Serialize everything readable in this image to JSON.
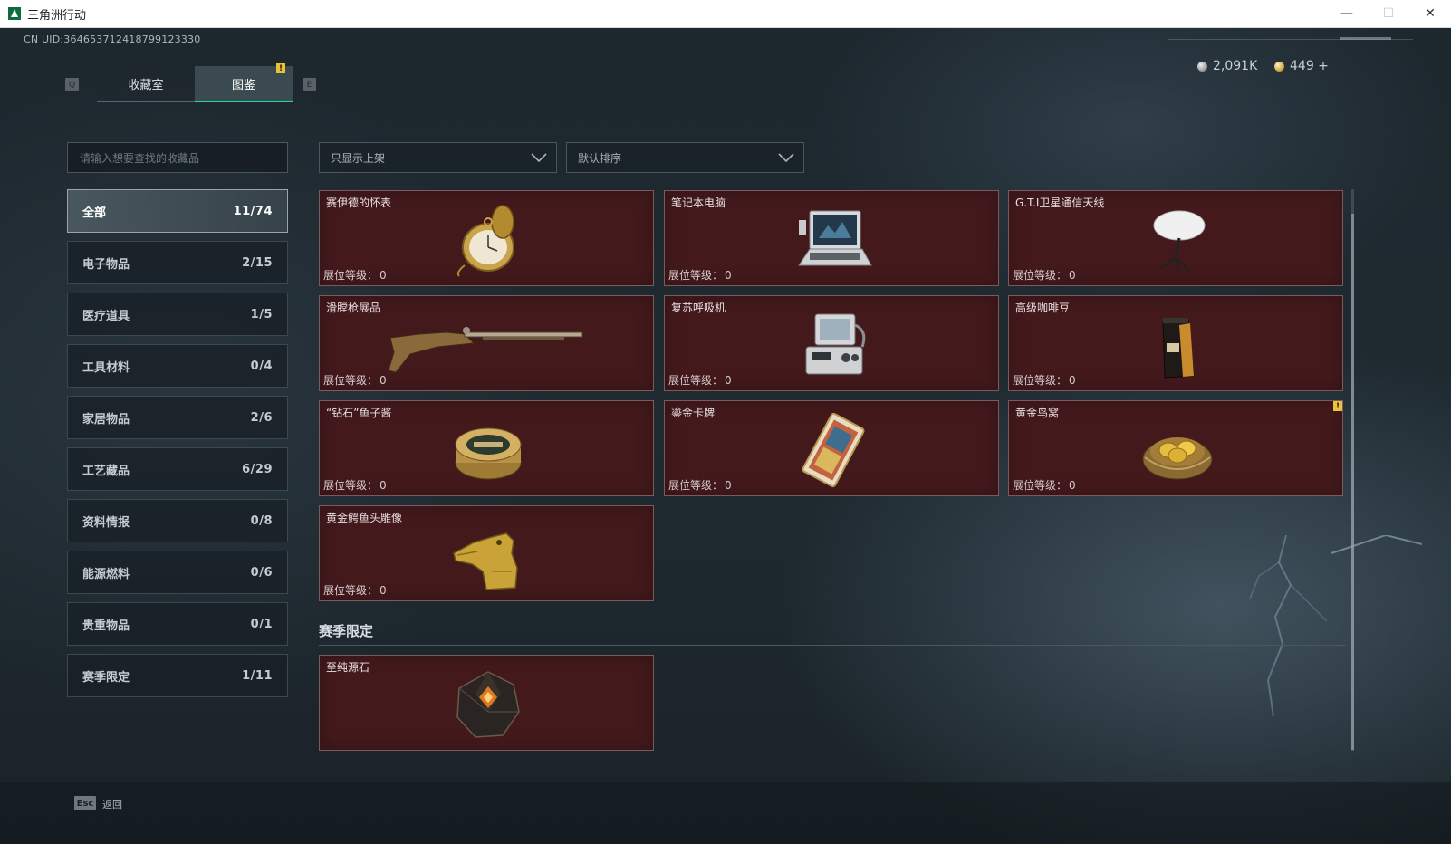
{
  "window": {
    "title": "三角洲行动",
    "controls": {
      "minimize": "—",
      "maximize": "☐",
      "close": "✕"
    }
  },
  "header": {
    "uid": "CN UID:364653712418799123330",
    "tab_prev_key": "Q",
    "tab_next_key": "E",
    "tabs": [
      {
        "label": "收藏室",
        "active": false
      },
      {
        "label": "图鉴",
        "active": true,
        "badge": "!"
      }
    ],
    "currency": [
      {
        "icon": "silver-coin-icon",
        "value": "2,091K"
      },
      {
        "icon": "gold-coin-icon",
        "value": "449 +"
      }
    ]
  },
  "sidebar": {
    "search_placeholder": "请输入想要查找的收藏品",
    "categories": [
      {
        "label": "全部",
        "count": "11/74",
        "active": true
      },
      {
        "label": "电子物品",
        "count": "2/15"
      },
      {
        "label": "医疗道具",
        "count": "1/5"
      },
      {
        "label": "工具材料",
        "count": "0/4"
      },
      {
        "label": "家居物品",
        "count": "2/6"
      },
      {
        "label": "工艺藏品",
        "count": "6/29"
      },
      {
        "label": "资料情报",
        "count": "0/8"
      },
      {
        "label": "能源燃料",
        "count": "0/6"
      },
      {
        "label": "贵重物品",
        "count": "0/1"
      },
      {
        "label": "赛季限定",
        "count": "1/11"
      }
    ]
  },
  "filters": {
    "display": "只显示上架",
    "sort": "默认排序"
  },
  "level_label": "展位等级：",
  "items": [
    {
      "name": "赛伊德的怀表",
      "level": "0",
      "icon": "pocket-watch-icon"
    },
    {
      "name": "笔记本电脑",
      "level": "0",
      "icon": "laptop-icon"
    },
    {
      "name": "G.T.I卫星通信天线",
      "level": "0",
      "icon": "satellite-dish-icon"
    },
    {
      "name": "滑膛枪展品",
      "level": "0",
      "icon": "musket-icon"
    },
    {
      "name": "复苏呼吸机",
      "level": "0",
      "icon": "ventilator-icon"
    },
    {
      "name": "高级咖啡豆",
      "level": "0",
      "icon": "coffee-bag-icon"
    },
    {
      "name": "“钻石”鱼子酱",
      "level": "0",
      "icon": "caviar-tin-icon"
    },
    {
      "name": "鎏金卡牌",
      "level": "0",
      "icon": "gilded-card-icon"
    },
    {
      "name": "黄金鸟窝",
      "level": "0",
      "icon": "golden-nest-icon",
      "badge": "!"
    },
    {
      "name": "黄金鳄鱼头雕像",
      "level": "0",
      "icon": "crocodile-statue-icon"
    }
  ],
  "season_section": {
    "title": "赛季限定",
    "items": [
      {
        "name": "至纯源石",
        "icon": "source-stone-icon"
      }
    ]
  },
  "footer": {
    "esc_key": "Esc",
    "back_label": "返回"
  }
}
